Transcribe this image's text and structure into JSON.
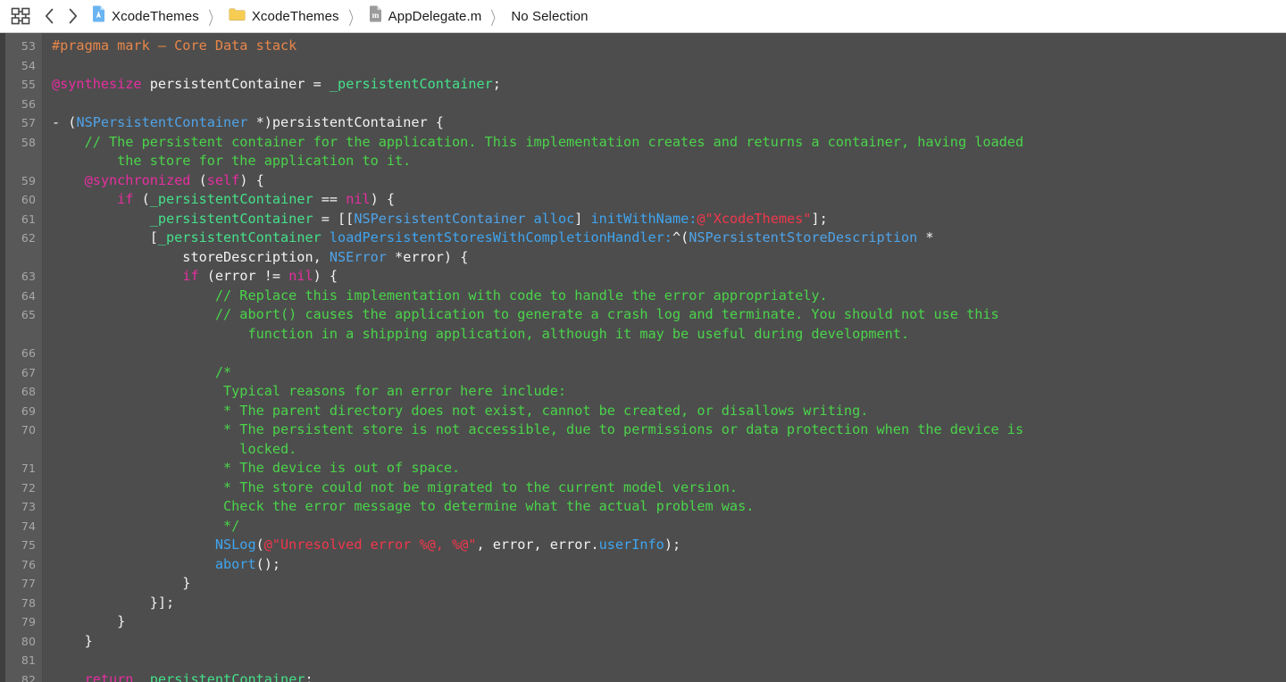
{
  "window": {
    "bg_editor": "#4d4d4d",
    "bg_gutter": "#585858",
    "bg_toolbar": "#ffffff"
  },
  "jumpbar": {
    "grid_icon": "grid-related-items-icon",
    "back_label": "‹",
    "forward_label": "›",
    "separator": "〉",
    "crumbs": [
      {
        "label": "XcodeThemes",
        "icon": "xcode-project-icon"
      },
      {
        "label": "XcodeThemes",
        "icon": "folder-icon"
      },
      {
        "label": "AppDelegate.m",
        "icon": "objc-implementation-file-icon"
      },
      {
        "label": "No Selection",
        "icon": "none"
      }
    ]
  },
  "editor": {
    "first_line": 53,
    "lines": [
      {
        "n": "53",
        "tokens": [
          {
            "t": "#pragma mark ",
            "c": "t-pre"
          },
          {
            "t": "— Core Data stack",
            "c": "t-pre"
          }
        ]
      },
      {
        "n": "54",
        "tokens": []
      },
      {
        "n": "55",
        "tokens": [
          {
            "t": "@synthesize",
            "c": "t-kw"
          },
          {
            "t": " persistentContainer = ",
            "c": "t-plain"
          },
          {
            "t": "_persistentContainer",
            "c": "t-ivar"
          },
          {
            "t": ";",
            "c": "t-plain"
          }
        ]
      },
      {
        "n": "56",
        "tokens": []
      },
      {
        "n": "57",
        "tokens": [
          {
            "t": "- (",
            "c": "t-plain"
          },
          {
            "t": "NSPersistentContainer",
            "c": "t-cls"
          },
          {
            "t": " *)persistentContainer {",
            "c": "t-plain"
          }
        ]
      },
      {
        "n": "58",
        "tokens": [
          {
            "t": "    // The persistent container for the application. This implementation creates and returns a container, having loaded",
            "c": "t-cmt"
          }
        ]
      },
      {
        "n": "",
        "tokens": [
          {
            "t": "        the store for the application to it.",
            "c": "t-cmt"
          }
        ]
      },
      {
        "n": "59",
        "tokens": [
          {
            "t": "    ",
            "c": "t-plain"
          },
          {
            "t": "@synchronized",
            "c": "t-kw"
          },
          {
            "t": " (",
            "c": "t-plain"
          },
          {
            "t": "self",
            "c": "t-kw"
          },
          {
            "t": ") {",
            "c": "t-plain"
          }
        ]
      },
      {
        "n": "60",
        "tokens": [
          {
            "t": "        ",
            "c": "t-plain"
          },
          {
            "t": "if",
            "c": "t-kw"
          },
          {
            "t": " (",
            "c": "t-plain"
          },
          {
            "t": "_persistentContainer",
            "c": "t-ivar"
          },
          {
            "t": " == ",
            "c": "t-plain"
          },
          {
            "t": "nil",
            "c": "t-kw"
          },
          {
            "t": ") {",
            "c": "t-plain"
          }
        ]
      },
      {
        "n": "61",
        "tokens": [
          {
            "t": "            ",
            "c": "t-plain"
          },
          {
            "t": "_persistentContainer",
            "c": "t-ivar"
          },
          {
            "t": " = [[",
            "c": "t-plain"
          },
          {
            "t": "NSPersistentContainer",
            "c": "t-cls"
          },
          {
            "t": " ",
            "c": "t-plain"
          },
          {
            "t": "alloc",
            "c": "t-fn"
          },
          {
            "t": "] ",
            "c": "t-plain"
          },
          {
            "t": "initWithName:",
            "c": "t-fn"
          },
          {
            "t": "@\"XcodeThemes\"",
            "c": "t-str"
          },
          {
            "t": "];",
            "c": "t-plain"
          }
        ]
      },
      {
        "n": "62",
        "tokens": [
          {
            "t": "            [",
            "c": "t-plain"
          },
          {
            "t": "_persistentContainer",
            "c": "t-ivar"
          },
          {
            "t": " ",
            "c": "t-plain"
          },
          {
            "t": "loadPersistentStoresWithCompletionHandler:",
            "c": "t-fn"
          },
          {
            "t": "^(",
            "c": "t-plain"
          },
          {
            "t": "NSPersistentStoreDescription",
            "c": "t-cls"
          },
          {
            "t": " *",
            "c": "t-plain"
          }
        ]
      },
      {
        "n": "",
        "tokens": [
          {
            "t": "                storeDescription, ",
            "c": "t-plain"
          },
          {
            "t": "NSError",
            "c": "t-cls"
          },
          {
            "t": " *error) {",
            "c": "t-plain"
          }
        ]
      },
      {
        "n": "63",
        "tokens": [
          {
            "t": "                ",
            "c": "t-plain"
          },
          {
            "t": "if",
            "c": "t-kw"
          },
          {
            "t": " (error != ",
            "c": "t-plain"
          },
          {
            "t": "nil",
            "c": "t-kw"
          },
          {
            "t": ") {",
            "c": "t-plain"
          }
        ]
      },
      {
        "n": "64",
        "tokens": [
          {
            "t": "                    // Replace this implementation with code to handle the error appropriately.",
            "c": "t-cmt"
          }
        ]
      },
      {
        "n": "65",
        "tokens": [
          {
            "t": "                    // abort() causes the application to generate a crash log and terminate. You should not use this",
            "c": "t-cmt"
          }
        ]
      },
      {
        "n": "",
        "tokens": [
          {
            "t": "                        function in a shipping application, although it may be useful during development.",
            "c": "t-cmt"
          }
        ]
      },
      {
        "n": "66",
        "tokens": []
      },
      {
        "n": "67",
        "tokens": [
          {
            "t": "                    /*",
            "c": "t-cmt"
          }
        ]
      },
      {
        "n": "68",
        "tokens": [
          {
            "t": "                     Typical reasons for an error here include:",
            "c": "t-cmt"
          }
        ]
      },
      {
        "n": "69",
        "tokens": [
          {
            "t": "                     * The parent directory does not exist, cannot be created, or disallows writing.",
            "c": "t-cmt"
          }
        ]
      },
      {
        "n": "70",
        "tokens": [
          {
            "t": "                     * The persistent store is not accessible, due to permissions or data protection when the device is",
            "c": "t-cmt"
          }
        ]
      },
      {
        "n": "",
        "tokens": [
          {
            "t": "                       locked.",
            "c": "t-cmt"
          }
        ]
      },
      {
        "n": "71",
        "tokens": [
          {
            "t": "                     * The device is out of space.",
            "c": "t-cmt"
          }
        ]
      },
      {
        "n": "72",
        "tokens": [
          {
            "t": "                     * The store could not be migrated to the current model version.",
            "c": "t-cmt"
          }
        ]
      },
      {
        "n": "73",
        "tokens": [
          {
            "t": "                     Check the error message to determine what the actual problem was.",
            "c": "t-cmt"
          }
        ]
      },
      {
        "n": "74",
        "tokens": [
          {
            "t": "                     */",
            "c": "t-cmt"
          }
        ]
      },
      {
        "n": "75",
        "tokens": [
          {
            "t": "                    ",
            "c": "t-plain"
          },
          {
            "t": "NSLog",
            "c": "t-fn"
          },
          {
            "t": "(",
            "c": "t-plain"
          },
          {
            "t": "@\"Unresolved error %@, %@\"",
            "c": "t-str"
          },
          {
            "t": ", error, error.",
            "c": "t-plain"
          },
          {
            "t": "userInfo",
            "c": "t-prop"
          },
          {
            "t": ");",
            "c": "t-plain"
          }
        ]
      },
      {
        "n": "76",
        "tokens": [
          {
            "t": "                    ",
            "c": "t-plain"
          },
          {
            "t": "abort",
            "c": "t-fn"
          },
          {
            "t": "();",
            "c": "t-plain"
          }
        ]
      },
      {
        "n": "77",
        "tokens": [
          {
            "t": "                }",
            "c": "t-plain"
          }
        ]
      },
      {
        "n": "78",
        "tokens": [
          {
            "t": "            }];",
            "c": "t-plain"
          }
        ]
      },
      {
        "n": "79",
        "tokens": [
          {
            "t": "        }",
            "c": "t-plain"
          }
        ]
      },
      {
        "n": "80",
        "tokens": [
          {
            "t": "    }",
            "c": "t-plain"
          }
        ]
      },
      {
        "n": "81",
        "tokens": []
      },
      {
        "n": "82",
        "tokens": [
          {
            "t": "    ",
            "c": "t-plain"
          },
          {
            "t": "return",
            "c": "t-kw"
          },
          {
            "t": " ",
            "c": "t-plain"
          },
          {
            "t": "_persistentContainer",
            "c": "t-ivar"
          },
          {
            "t": ";",
            "c": "t-plain"
          }
        ]
      }
    ]
  }
}
